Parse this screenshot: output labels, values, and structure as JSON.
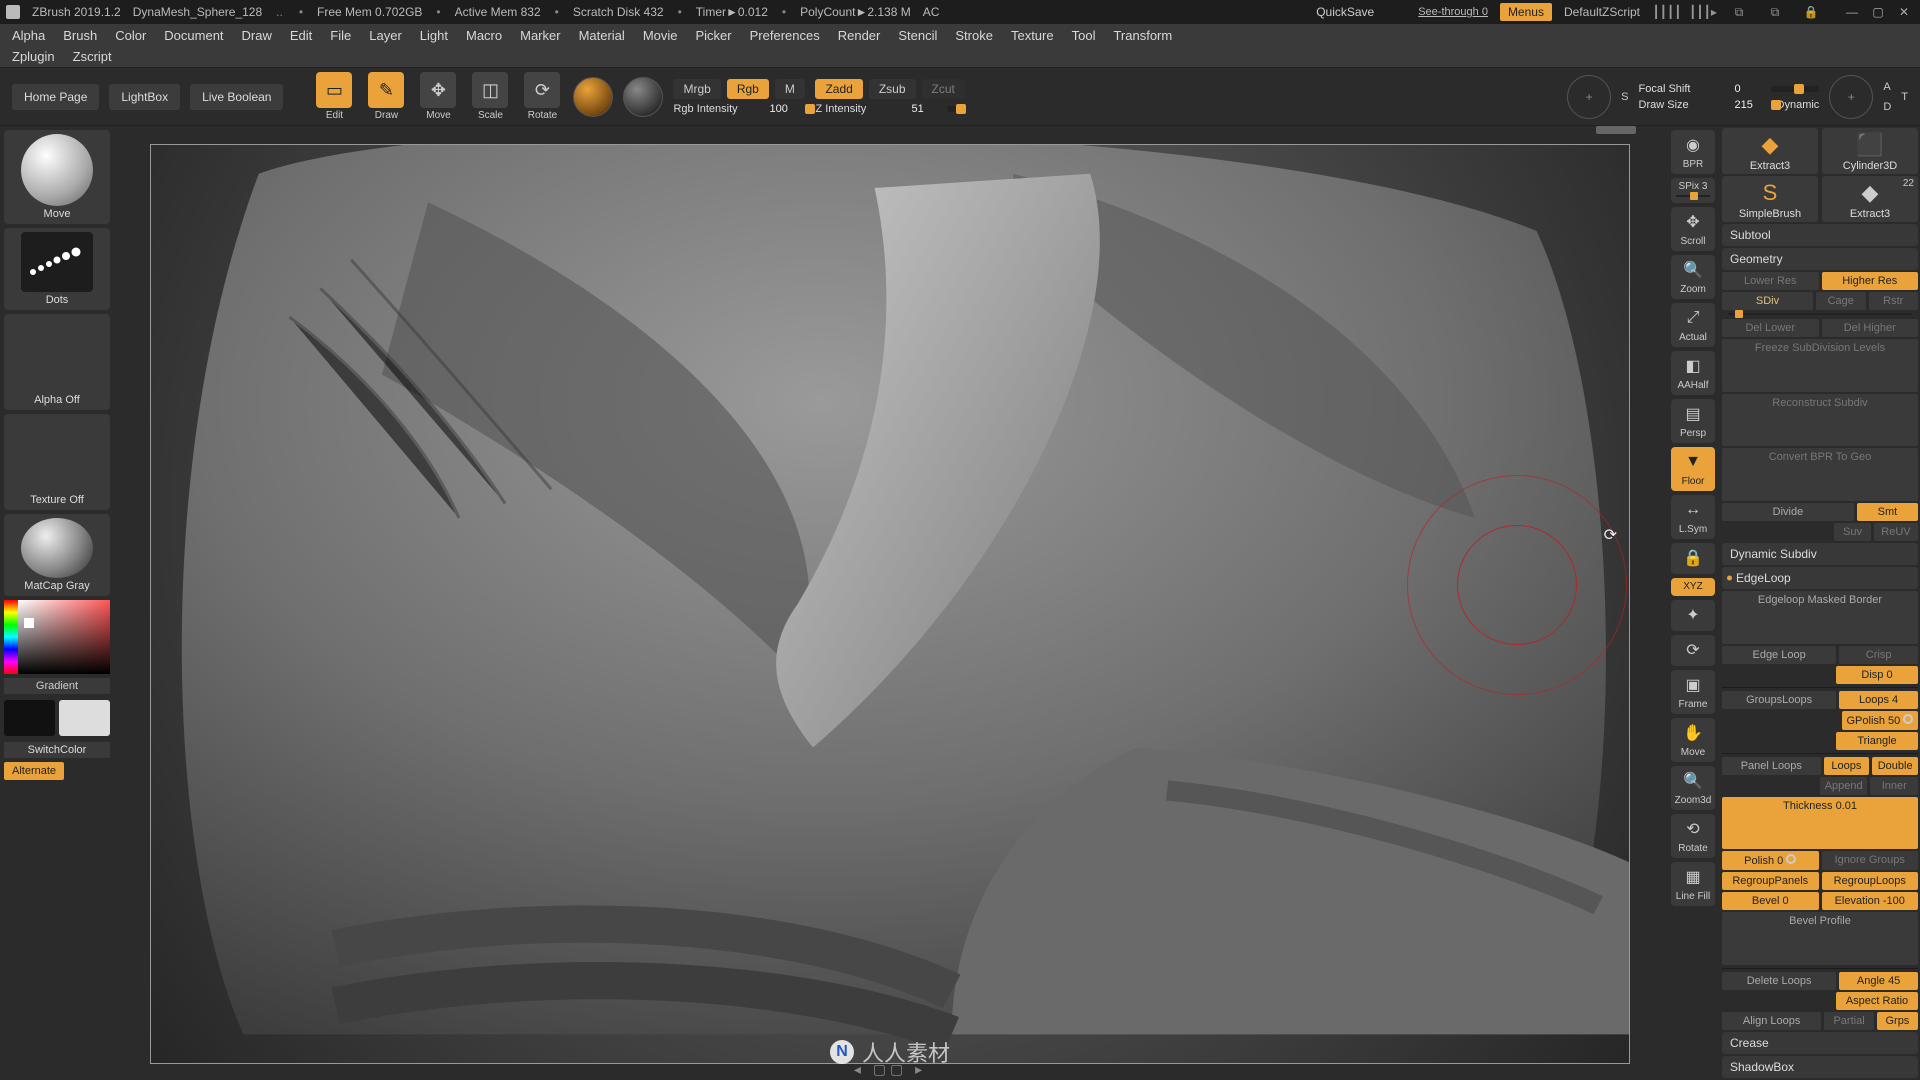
{
  "titlebar": {
    "app": "ZBrush 2019.1.2",
    "project": "DynaMesh_Sphere_128",
    "status": [
      "Free Mem 0.702GB",
      "Active Mem 832",
      "Scratch Disk 432",
      "Timer►0.012",
      "PolyCount►2.138 M",
      "AC"
    ],
    "quicksave": "QuickSave",
    "see_through": "See-through  0",
    "menus": "Menus",
    "default_script": "DefaultZScript"
  },
  "menubar": [
    "Alpha",
    "Brush",
    "Color",
    "Document",
    "Draw",
    "Edit",
    "File",
    "Layer",
    "Light",
    "Macro",
    "Marker",
    "Material",
    "Movie",
    "Picker",
    "Preferences",
    "Render",
    "Stencil",
    "Stroke",
    "Texture",
    "Tool",
    "Transform"
  ],
  "menubar2": [
    "Zplugin",
    "Zscript"
  ],
  "shelf": {
    "tabs": [
      "Home Page",
      "LightBox",
      "Live Boolean"
    ],
    "tools": [
      {
        "label": "Edit",
        "icon": "✎",
        "active": true
      },
      {
        "label": "Draw",
        "icon": "✏",
        "active": true
      },
      {
        "label": "Move",
        "icon": "✥",
        "active": false
      },
      {
        "label": "Scale",
        "icon": "◫",
        "active": false
      },
      {
        "label": "Rotate",
        "icon": "⟳",
        "active": false
      }
    ],
    "modes": {
      "mrgb": "Mrgb",
      "rgb": "Rgb",
      "m": "M",
      "zadd": "Zadd",
      "zsub": "Zsub",
      "zcut": "Zcut"
    },
    "sliders": {
      "rgb_label": "Rgb Intensity",
      "rgb_val": "100",
      "zint_label": "Z Intensity",
      "zint_val": "51",
      "focal_label": "Focal Shift",
      "focal_val": "0",
      "draw_label": "Draw Size",
      "draw_val": "215"
    },
    "dynamic": "Dynamic",
    "corners": {
      "s": "S",
      "a": "A",
      "d": "D",
      "t": "T"
    }
  },
  "left": {
    "brush": "Move",
    "stroke": "Dots",
    "alpha": "Alpha Off",
    "texture": "Texture Off",
    "material": "MatCap Gray",
    "gradient": "Gradient",
    "switch": "SwitchColor",
    "alternate": "Alternate"
  },
  "rail": [
    {
      "label": "BPR",
      "active": false
    },
    {
      "label": "SPix 3",
      "active": false
    },
    {
      "label": "Scroll",
      "active": false
    },
    {
      "label": "Zoom",
      "active": false
    },
    {
      "label": "Actual",
      "active": false
    },
    {
      "label": "AAHalf",
      "active": false
    },
    {
      "label": "Persp",
      "active": false
    },
    {
      "label": "Floor",
      "active": true
    },
    {
      "label": "L.Sym",
      "active": false
    },
    {
      "label": "",
      "active": false
    },
    {
      "label": "XYZ",
      "active": true
    },
    {
      "label": "",
      "active": false
    },
    {
      "label": "",
      "active": false
    },
    {
      "label": "Frame",
      "active": false
    },
    {
      "label": "Move",
      "active": false
    },
    {
      "label": "Zoom3d",
      "active": false
    },
    {
      "label": "Rotate",
      "active": false
    },
    {
      "label": "Line Fill",
      "active": false
    }
  ],
  "tooltray": [
    {
      "label": "Extract3",
      "num": ""
    },
    {
      "label": "Cylinder3D",
      "num": ""
    },
    {
      "label": "SimpleBrush",
      "num": ""
    },
    {
      "label": "Extract3",
      "num": "22"
    }
  ],
  "panel": {
    "subtool": "Subtool",
    "geometry": "Geometry",
    "lowres": "Lower Res",
    "highres": "Higher Res",
    "sdiv": "SDiv",
    "cage": "Cage",
    "rstr": "Rstr",
    "dellower": "Del Lower",
    "delhigher": "Del Higher",
    "freeze": "Freeze SubDivision Levels",
    "reconstruct": "Reconstruct Subdiv",
    "convertbpr": "Convert BPR To Geo",
    "divide": "Divide",
    "smt": "Smt",
    "suv": "Suv",
    "reuv": "ReUV",
    "dynsub": "Dynamic Subdiv",
    "edgeloop_hdr": "EdgeLoop",
    "edgeloop_border": "Edgeloop Masked Border",
    "edge_loop": "Edge Loop",
    "crisp": "Crisp",
    "disp": "Disp 0",
    "groupsloops": "GroupsLoops",
    "loops_n": "Loops 4",
    "gpolish": "GPolish 50",
    "triangle": "Triangle",
    "panel_loops": "Panel Loops",
    "loops": "Loops",
    "double": "Double",
    "append": "Append",
    "inner": "Inner",
    "thickness": "Thickness 0.01",
    "polish": "Polish 0",
    "ignore": "Ignore Groups",
    "regroup_panel": "RegroupPanels",
    "regroup_loops": "RegroupLoops",
    "bevel": "Bevel 0",
    "elevation": "Elevation -100",
    "bevel_profile": "Bevel Profile",
    "delete_loops": "Delete Loops",
    "angle": "Angle 45",
    "aspect": "Aspect Ratio",
    "align_loops": "Align Loops",
    "partial": "Partial",
    "grps": "Grps",
    "crease": "Crease",
    "shadowbox": "ShadowBox"
  },
  "footer_brand": "人人素材"
}
